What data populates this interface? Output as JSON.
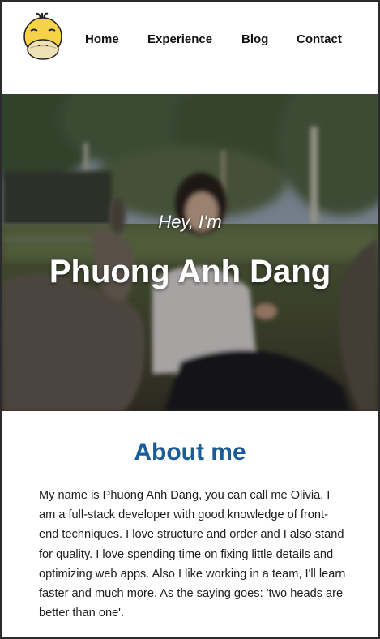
{
  "nav": {
    "home": "Home",
    "experience": "Experience",
    "blog": "Blog",
    "contact": "Contact"
  },
  "hero": {
    "greeting": "Hey, I'm",
    "name": "Phuong Anh Dang"
  },
  "about": {
    "title": "About me",
    "text": "My name is Phuong Anh Dang, you can call me Olivia. I am a full-stack developer with good knowledge of front-end techniques. I love structure and order and I also stand for quality. I love spending time on fixing little details and optimizing web apps. Also I like working in a team, I'll learn faster and much more. As the saying goes: 'two heads are better than one'."
  },
  "icons": {
    "logo": "psyduck-logo-icon"
  },
  "colors": {
    "accent": "#1a5c96",
    "logo_yellow": "#f5d246",
    "logo_beak": "#eee2b4"
  }
}
